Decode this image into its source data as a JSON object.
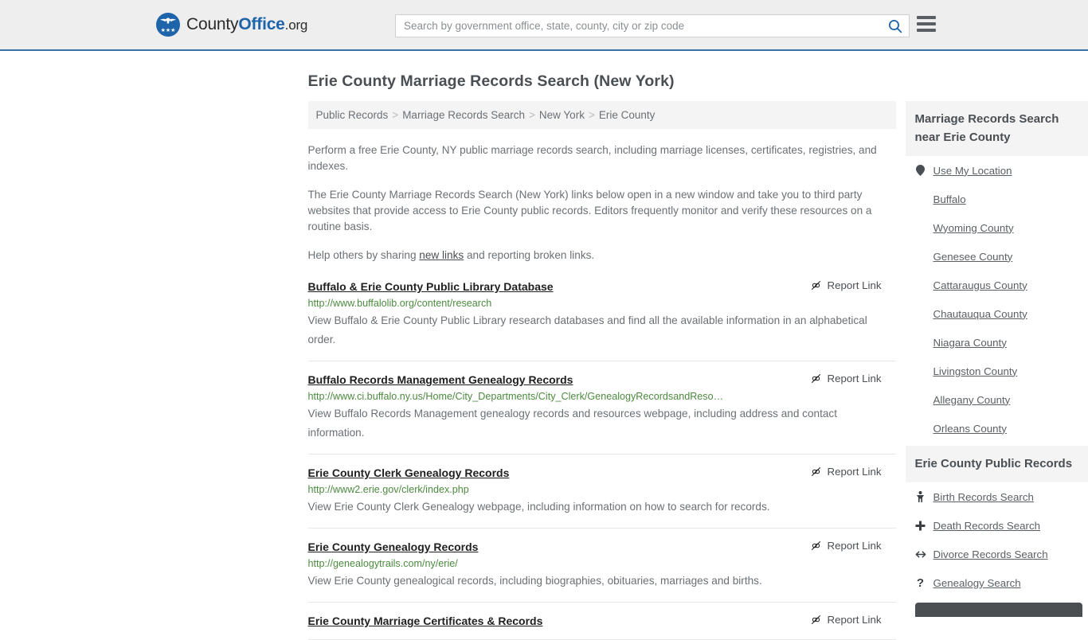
{
  "header": {
    "brand": {
      "part1": "County",
      "part2": "Office",
      "part3": ".org",
      "logo_icon": "eagle-seal-logo",
      "stars": "★★★"
    },
    "search": {
      "placeholder": "Search by government office, state, county, city or zip code",
      "value": "",
      "icon": "search-icon"
    },
    "menu_icon": "hamburger-menu-icon",
    "accent_color": "#3a72a8",
    "background_color": "#eeeeee"
  },
  "page": {
    "title": "Erie County Marriage Records Search (New York)"
  },
  "breadcrumb": {
    "separator": ">",
    "items": [
      {
        "label": "Public Records"
      },
      {
        "label": "Marriage Records Search"
      },
      {
        "label": "New York"
      },
      {
        "label": "Erie County"
      }
    ]
  },
  "intro": {
    "p1": "Perform a free Erie County, NY public marriage records search, including marriage licenses, certificates, registries, and indexes.",
    "p2": "The Erie County Marriage Records Search (New York) links below open in a new window and take you to third party websites that provide access to Erie County public records. Editors frequently monitor and verify these resources on a routine basis.",
    "p3_before": "Help others by sharing ",
    "p3_link": "new links",
    "p3_after": " and reporting broken links."
  },
  "results": {
    "report_label": "Report Link",
    "report_icon": "broken-link-icon",
    "items": [
      {
        "title": "Buffalo & Erie County Public Library Database",
        "url": "http://www.buffalolib.org/content/research",
        "description": "View Buffalo & Erie County Public Library research databases and find all the available information in an alphabetical order."
      },
      {
        "title": "Buffalo Records Management Genealogy Records",
        "url": "http://www.ci.buffalo.ny.us/Home/City_Departments/City_Clerk/GenealogyRecordsandReso…",
        "description": "View Buffalo Records Management genealogy records and resources webpage, including address and contact information."
      },
      {
        "title": "Erie County Clerk Genealogy Records",
        "url": "http://www2.erie.gov/clerk/index.php",
        "description": "View Erie County Clerk Genealogy webpage, including information on how to search for records."
      },
      {
        "title": "Erie County Genealogy Records",
        "url": "http://genealogytrails.com/ny/erie/",
        "description": "View Erie County genealogical records, including biographies, obituaries, marriages and births."
      },
      {
        "title": "Erie County Marriage Certificates & Records",
        "url": "",
        "description": ""
      }
    ]
  },
  "sidebar": {
    "nearby": {
      "heading": "Marriage Records Search near Erie County",
      "items": [
        {
          "label": "Use My Location",
          "icon": "map-pin-icon"
        },
        {
          "label": "Buffalo",
          "icon": ""
        },
        {
          "label": "Wyoming County",
          "icon": ""
        },
        {
          "label": "Genesee County",
          "icon": ""
        },
        {
          "label": "Cattaraugus County",
          "icon": ""
        },
        {
          "label": "Chautauqua County",
          "icon": ""
        },
        {
          "label": "Niagara County",
          "icon": ""
        },
        {
          "label": "Livingston County",
          "icon": ""
        },
        {
          "label": "Allegany County",
          "icon": ""
        },
        {
          "label": "Orleans County",
          "icon": ""
        }
      ]
    },
    "public_records": {
      "heading": "Erie County Public Records",
      "items": [
        {
          "label": "Birth Records Search",
          "icon": "baby-icon",
          "glyph": "⚲"
        },
        {
          "label": "Death Records Search",
          "icon": "cross-icon",
          "glyph": "✚"
        },
        {
          "label": "Divorce Records Search",
          "icon": "left-right-arrow-icon",
          "glyph": "↔"
        },
        {
          "label": "Genealogy Search",
          "icon": "question-mark-icon",
          "glyph": "?"
        }
      ]
    }
  }
}
